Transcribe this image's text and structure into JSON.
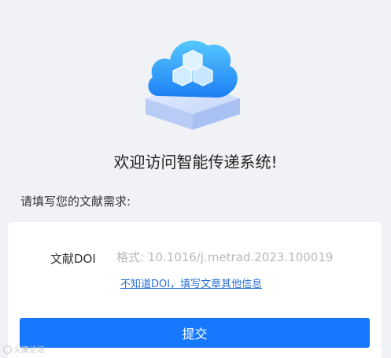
{
  "header": {
    "logo_icon": "cloud-cubes-icon",
    "welcome_text": "欢迎访问智能传递系统!"
  },
  "form": {
    "prompt": "请填写您的文献需求:",
    "doi_label": "文献DOI",
    "doi_value": "",
    "doi_placeholder": "格式: 10.1016/j.metrad.2023.100019",
    "no_doi_link": "不知道DOI，填写文章其他信息",
    "submit_label": "提交"
  },
  "watermark": {
    "text": "火鹰论坛"
  },
  "colors": {
    "accent": "#1677ff",
    "link": "#2a6fd6",
    "background": "#f0f2f5"
  }
}
